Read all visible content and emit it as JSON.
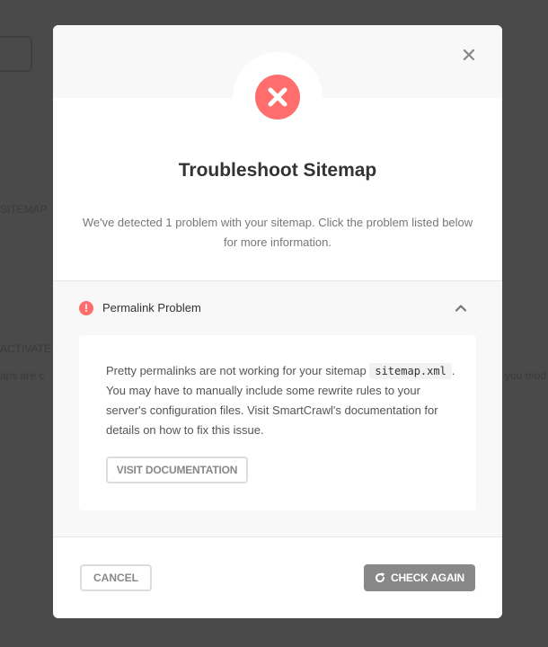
{
  "background": {
    "fragments": [
      "SITEMAP",
      "ACTIVATE",
      "aps are c",
      "you mod"
    ]
  },
  "modal": {
    "close_icon": "close-icon",
    "status_icon": "error-x-icon",
    "title": "Troubleshoot Sitemap",
    "intro": "We've detected 1 problem with your sitemap. Click the problem listed below for more information."
  },
  "problem": {
    "icon": "exclamation-circle-icon",
    "title": "Permalink Problem",
    "expanded": true,
    "text_before_code": "Pretty permalinks are not working for your sitemap",
    "code": "sitemap.xml",
    "text_after_code": ". You may have to manually include some rewrite rules to your server's configuration files. Visit SmartCrawl's documentation for details on how to fix this issue.",
    "button_label": "VISIT DOCUMENTATION"
  },
  "footer": {
    "cancel_label": "CANCEL",
    "check_label": "CHECK AGAIN",
    "check_icon": "refresh-icon"
  },
  "colors": {
    "overlay": "#4a4a4a",
    "error_red": "#ff6d6d",
    "check_button": "#888888"
  }
}
